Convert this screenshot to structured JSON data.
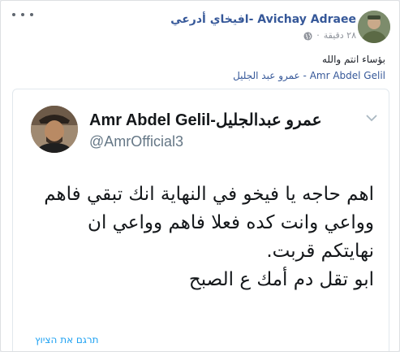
{
  "post": {
    "author": "Avichay Adraee -افيخاي أدرعي",
    "timestamp": "٢٨ دقيقة",
    "line1": "بؤساء انتم والله",
    "line2": "Amr Abdel Gelil - عمرو عبد الجليل"
  },
  "tweet": {
    "name": "Amr Abdel Gelil-عمرو عبدالجليل",
    "handle": "@AmrOfficial3",
    "body_lines": [
      "اهم حاجه يا فيخو في النهاية انك تبقي فاهم",
      "وواعي وانت كده فعلا فاهم وواعي ان",
      "نهايتكم قربت.",
      "ابو تقل دم أمك ع الصبح"
    ],
    "translate_label": "תרגם את הציוץ"
  },
  "icons": {
    "more": "more-options-icon",
    "globe": "globe-icon",
    "chevron": "chevron-down-icon"
  },
  "colors": {
    "link": "#365899",
    "twitter_blue": "#1da1f2",
    "meta_gray": "#90949c"
  }
}
